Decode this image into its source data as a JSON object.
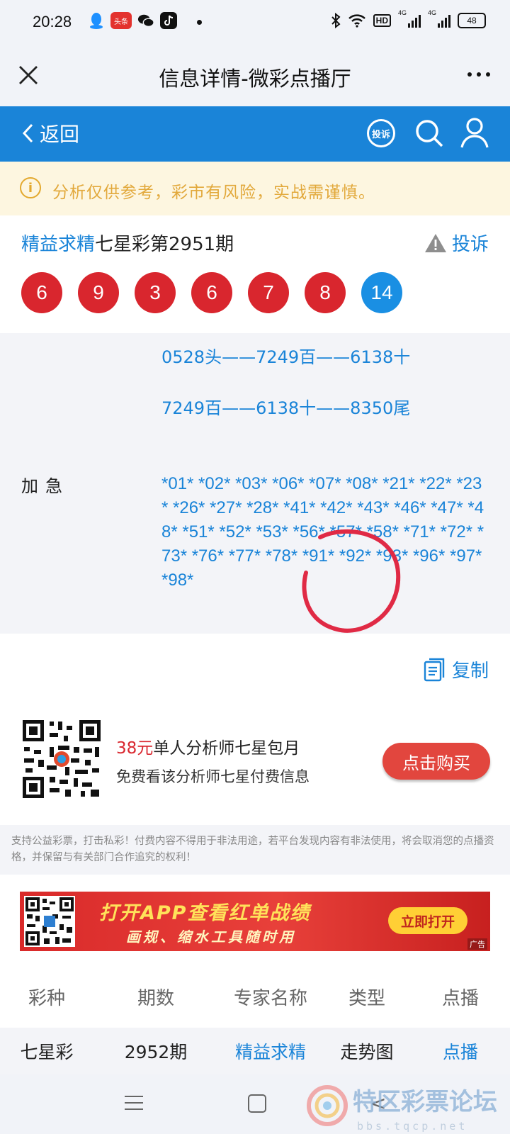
{
  "status_bar": {
    "time": "20:28",
    "app_badge": "头条",
    "hd": "HD",
    "network_1": "4G",
    "network_2": "4G",
    "battery": "48",
    "icons": [
      "qq-icon",
      "toutiao-icon",
      "wechat-icon",
      "tiktok-icon",
      "bluetooth-icon",
      "wifi-icon",
      "signal-icon",
      "battery-icon"
    ]
  },
  "titlebar": {
    "title": "信息详情-微彩点播厅"
  },
  "navbar": {
    "back_label": "返回",
    "report_label": "投诉",
    "color": "#1a84d8"
  },
  "notice": {
    "icon_text": "i",
    "text": "分析仅供参考，彩市有风险，实战需谨慎。"
  },
  "article": {
    "author": "精益求精",
    "title_rest": "七星彩第2951期",
    "complain_label": "投诉",
    "balls": [
      {
        "value": "6",
        "color": "red"
      },
      {
        "value": "9",
        "color": "red"
      },
      {
        "value": "3",
        "color": "red"
      },
      {
        "value": "6",
        "color": "red"
      },
      {
        "value": "7",
        "color": "red"
      },
      {
        "value": "8",
        "color": "red"
      },
      {
        "value": "14",
        "color": "blue"
      }
    ],
    "line1": "0528头——7249百——6138十",
    "line2": "7249百——6138十——8350尾",
    "label": "加急",
    "numbers": "*01* *02* *03* *06* *07* *08* *21* *22* *23* *26* *27* *28* *41* *42* *43* *46* *47* *48* *51* *52* *53* *56* *57* *58* *71* *72* *73* *76* *77* *78* *91* *92* *93* *96* *97* *98*",
    "copy_label": "复制"
  },
  "promo": {
    "price": "38元",
    "price_text": "单人分析师七星包月",
    "sub": "免费看该分析师七星付费信息",
    "buy_label": "点击购买"
  },
  "disclaimer": "支持公益彩票，打击私彩！付费内容不得用于非法用途，若平台发现内容有非法使用，将会取消您的点播资格，并保留与有关部门合作追究的权利！",
  "banner": {
    "title": "打开APP查看红单战绩",
    "subtitle": "画规、缩水工具随时用",
    "button": "立即打开",
    "ad_tag": "广告"
  },
  "table": {
    "headers": [
      "彩种",
      "期数",
      "专家名称",
      "类型",
      "点播"
    ],
    "rows": [
      [
        "七星彩",
        "2952期",
        "精益求精",
        "走势图",
        "点播"
      ]
    ]
  },
  "watermark": {
    "text": "特区彩票论坛",
    "sub": "bbs.tqcp.net"
  }
}
